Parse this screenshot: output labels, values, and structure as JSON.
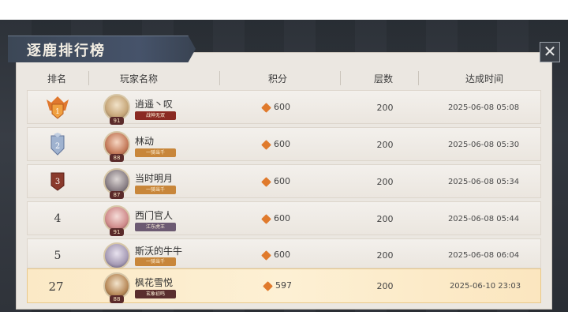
{
  "title": "逐鹿排行榜",
  "close_label": "✕",
  "headers": {
    "rank": "排名",
    "player": "玩家名称",
    "score": "积分",
    "floors": "层数",
    "time": "达成时间"
  },
  "rows": [
    {
      "rank": "1",
      "name": "逍遥丶叹",
      "tag": "战神无双",
      "level": "91",
      "score": "600",
      "floors": "200",
      "time": "2025-06-08 05:08",
      "tag_color": "#8a2a22",
      "badge": "gold-crest-icon"
    },
    {
      "rank": "2",
      "name": "林动",
      "tag": "一骑当千",
      "level": "88",
      "score": "600",
      "floors": "200",
      "time": "2025-06-08 05:30",
      "tag_color": "#c8863a",
      "badge": "silver-crest-icon"
    },
    {
      "rank": "3",
      "name": "当时明月",
      "tag": "一骑当千",
      "level": "87",
      "score": "600",
      "floors": "200",
      "time": "2025-06-08 05:34",
      "tag_color": "#c8863a",
      "badge": "bronze-crest-icon"
    },
    {
      "rank": "4",
      "name": "西门官人",
      "tag": "江东虎王",
      "level": "91",
      "score": "600",
      "floors": "200",
      "time": "2025-06-08 05:44",
      "tag_color": "#6c5a72"
    },
    {
      "rank": "5",
      "name": "斯沃的牛牛",
      "tag": "一骑当千",
      "level": "",
      "score": "600",
      "floors": "200",
      "time": "2025-06-08 06:04",
      "tag_color": "#c8863a"
    }
  ],
  "me": {
    "rank": "27",
    "name": "枫花雪悦",
    "tag": "玄象初鸣",
    "level": "88",
    "score": "597",
    "floors": "200",
    "time": "2025-06-10 23:03",
    "tag_color": "#5a2e2e"
  },
  "colors": {
    "accent": "#e07a2c",
    "highlight_row": "#fbe9c6",
    "panel": "#ebe7e1"
  }
}
